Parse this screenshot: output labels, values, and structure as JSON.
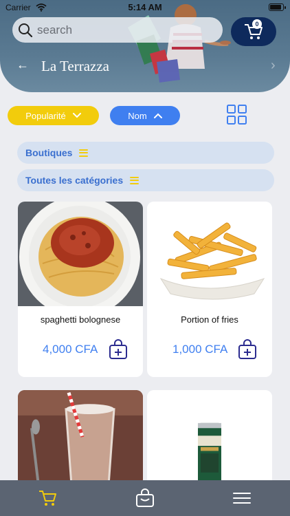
{
  "status": {
    "carrier": "Carrier",
    "time": "5:14 AM"
  },
  "search": {
    "placeholder": "search"
  },
  "cart": {
    "count": "0"
  },
  "header": {
    "title": "La Terrazza",
    "back": "←",
    "next": "›"
  },
  "filters": {
    "popularity": "Popularité",
    "name": "Nom"
  },
  "categories": {
    "shops": "Boutiques",
    "all": "Toutes les catégories"
  },
  "products": [
    {
      "name": "spaghetti bolognese",
      "price": "4,000 CFA"
    },
    {
      "name": "Portion of fries",
      "price": "1,000 CFA"
    },
    {
      "name": "",
      "price": ""
    },
    {
      "name": "",
      "price": ""
    }
  ],
  "colors": {
    "accent_blue": "#3f7ff0",
    "accent_yellow": "#f2cc0c",
    "navy": "#0e2a5c",
    "nav_bg": "#5b6472"
  },
  "icons": {
    "search": "search-icon",
    "cart": "cart-icon",
    "grid": "grid-view-icon",
    "bag": "shopping-bag-add-icon",
    "menu": "menu-icon"
  }
}
